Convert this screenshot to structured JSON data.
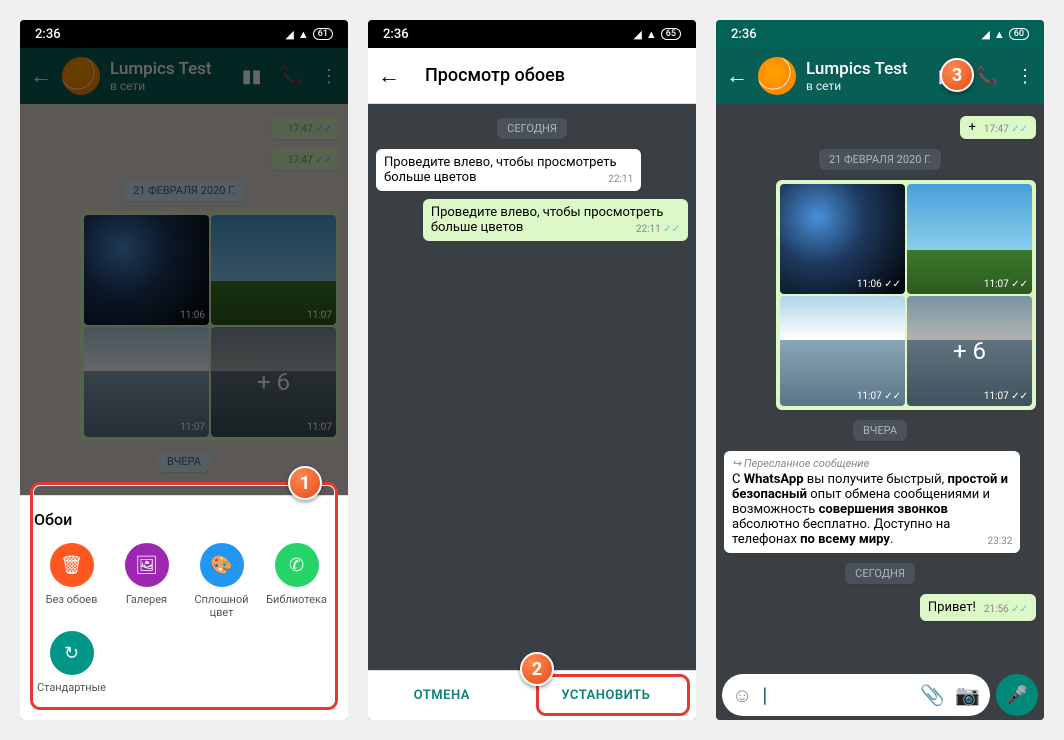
{
  "status": {
    "time": "2:36",
    "battery1": "61",
    "battery2": "65",
    "battery3": "60"
  },
  "header": {
    "contact": "Lumpics Test",
    "status": "в сети",
    "preview_title": "Просмотр обоев"
  },
  "dates": {
    "today": "СЕГОДНЯ",
    "yesterday": "ВЧЕРА",
    "feb21": "21 ФЕВРАЛЯ 2020 Г."
  },
  "preview": {
    "msg1": "Проведите влево, чтобы просмотреть больше цветов",
    "msg1_time": "22:11",
    "msg2": "Проведите влево, чтобы просмотреть больше цветов",
    "msg2_time": "22:11"
  },
  "buttons": {
    "cancel": "ОТМЕНА",
    "set": "УСТАНОВИТЬ"
  },
  "sheet": {
    "title": "Обои",
    "items": {
      "none": "Без обоев",
      "gallery": "Галерея",
      "solid": "Сплошной цвет",
      "library": "Библиотека",
      "default": "Стандартные"
    }
  },
  "media": {
    "t1": "11:06",
    "t2": "11:07",
    "t3": "11:07",
    "t4": "11:07",
    "plus": "+ 6"
  },
  "msg_out_time1": "17:47",
  "msg_out_time2": "17:47",
  "forwarded_label": "Пересланное сообщение",
  "long_time": "23:32",
  "hello": "Привет!",
  "hello_time": "21:56",
  "callouts": {
    "c1": "1",
    "c2": "2",
    "c3": "3"
  },
  "rich": {
    "t1": "С ",
    "b1": "WhatsApp",
    "t2": " вы получите быстрый, ",
    "b2": "простой и безопасный",
    "t3": " опыт обмена сообщениями и возможность ",
    "b3": "совершения звонков",
    "t4": " абсолютно бесплатно. Доступно на телефонах ",
    "b4": "по всему миру",
    "t5": "."
  }
}
